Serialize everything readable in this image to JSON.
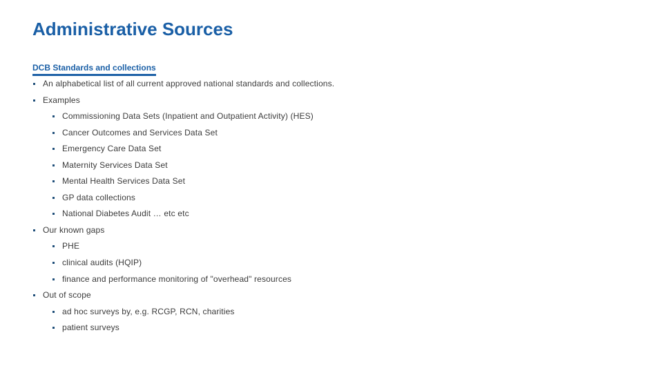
{
  "slide": {
    "title": "Administrative Sources",
    "subheading": "DCB Standards and collections",
    "colors": {
      "accent": "#1a5fa6",
      "text": "#3a3a3a",
      "bullet": "#1f4e79"
    },
    "bullets": [
      {
        "level": 1,
        "text": "An alphabetical list of all current approved national standards and collections."
      },
      {
        "level": 1,
        "text": "Examples"
      },
      {
        "level": 2,
        "text": "Commissioning Data Sets (Inpatient and Outpatient Activity) (HES)"
      },
      {
        "level": 2,
        "text": "Cancer Outcomes and Services Data Set"
      },
      {
        "level": 2,
        "text": "Emergency Care Data Set"
      },
      {
        "level": 2,
        "text": "Maternity Services Data Set"
      },
      {
        "level": 2,
        "text": "Mental Health Services Data Set"
      },
      {
        "level": 2,
        "text": "GP data collections"
      },
      {
        "level": 2,
        "text": "National Diabetes Audit … etc etc"
      },
      {
        "level": 1,
        "text": "Our known gaps"
      },
      {
        "level": 2,
        "text": "PHE"
      },
      {
        "level": 2,
        "text": "clinical audits (HQIP)"
      },
      {
        "level": 2,
        "text": "finance and performance monitoring of \"overhead\" resources"
      },
      {
        "level": 1,
        "text": "Out of scope"
      },
      {
        "level": 2,
        "text": "ad hoc surveys by, e.g. RCGP, RCN, charities"
      },
      {
        "level": 2,
        "text": "patient surveys"
      }
    ]
  }
}
